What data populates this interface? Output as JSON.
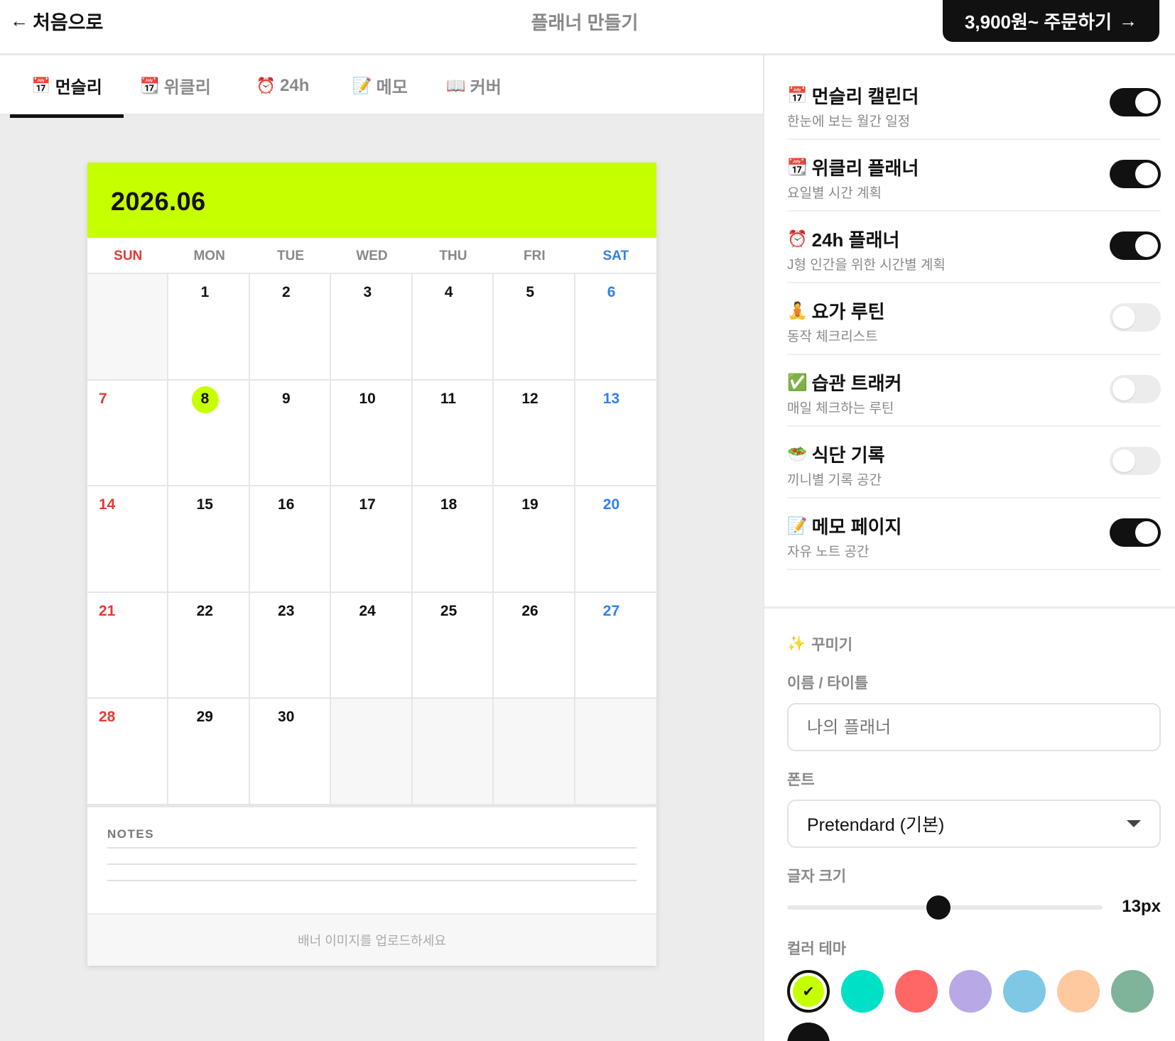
{
  "header": {
    "back_label": "처음으로",
    "title": "플래너 만들기",
    "order_label": "3,900원~ 주문하기",
    "order_arrow": "→"
  },
  "tabs": [
    {
      "icon": "📅",
      "label": "먼슬리"
    },
    {
      "icon": "📆",
      "label": "위클리"
    },
    {
      "icon": "⏰",
      "label": "24h"
    },
    {
      "icon": "📝",
      "label": "메모"
    },
    {
      "icon": "📖",
      "label": "커버"
    }
  ],
  "calendar": {
    "title": "2026.06",
    "weekdays": [
      "SUN",
      "MON",
      "TUE",
      "WED",
      "THU",
      "FRI",
      "SAT"
    ],
    "weeks": [
      [
        "",
        "1",
        "2",
        "3",
        "4",
        "5",
        "6"
      ],
      [
        "7",
        "8",
        "9",
        "10",
        "11",
        "12",
        "13"
      ],
      [
        "14",
        "15",
        "16",
        "17",
        "18",
        "19",
        "20"
      ],
      [
        "21",
        "22",
        "23",
        "24",
        "25",
        "26",
        "27"
      ],
      [
        "28",
        "29",
        "30",
        "",
        "",
        "",
        ""
      ]
    ],
    "today": "8",
    "notes_label": "NOTES",
    "banner_text": "배너 이미지를 업로드하세요",
    "accent_color": "#c6ff00"
  },
  "options": [
    {
      "icon": "📅",
      "title": "먼슬리 캘린더",
      "sub": "한눈에 보는 월간 일정",
      "on": true
    },
    {
      "icon": "📆",
      "title": "위클리 플래너",
      "sub": "요일별 시간 계획",
      "on": true
    },
    {
      "icon": "⏰",
      "title": "24h 플래너",
      "sub": "J형 인간을 위한 시간별 계획",
      "on": true
    },
    {
      "icon": "🧘",
      "title": "요가 루틴",
      "sub": "동작 체크리스트",
      "on": false
    },
    {
      "icon": "✅",
      "title": "습관 트래커",
      "sub": "매일 체크하는 루틴",
      "on": false
    },
    {
      "icon": "🥗",
      "title": "식단 기록",
      "sub": "끼니별 기록 공간",
      "on": false
    },
    {
      "icon": "📝",
      "title": "메모 페이지",
      "sub": "자유 노트 공간",
      "on": true
    }
  ],
  "decorate": {
    "icon": "✨",
    "title": "꾸미기",
    "name_label": "이름 / 타이틀",
    "name_placeholder": "나의 플래너",
    "font_label": "폰트",
    "font_value": "Pretendard (기본)",
    "size_label": "글자 크기",
    "size_value": "13px",
    "size_fraction": 0.48,
    "theme_label": "컬러 테마",
    "themes": [
      "#c6ff00",
      "#00e0c6",
      "#ff6666",
      "#b9a8e6",
      "#7ec8e6",
      "#ffc9a0",
      "#7fb39a",
      "#111111"
    ],
    "selected_theme": 0
  }
}
